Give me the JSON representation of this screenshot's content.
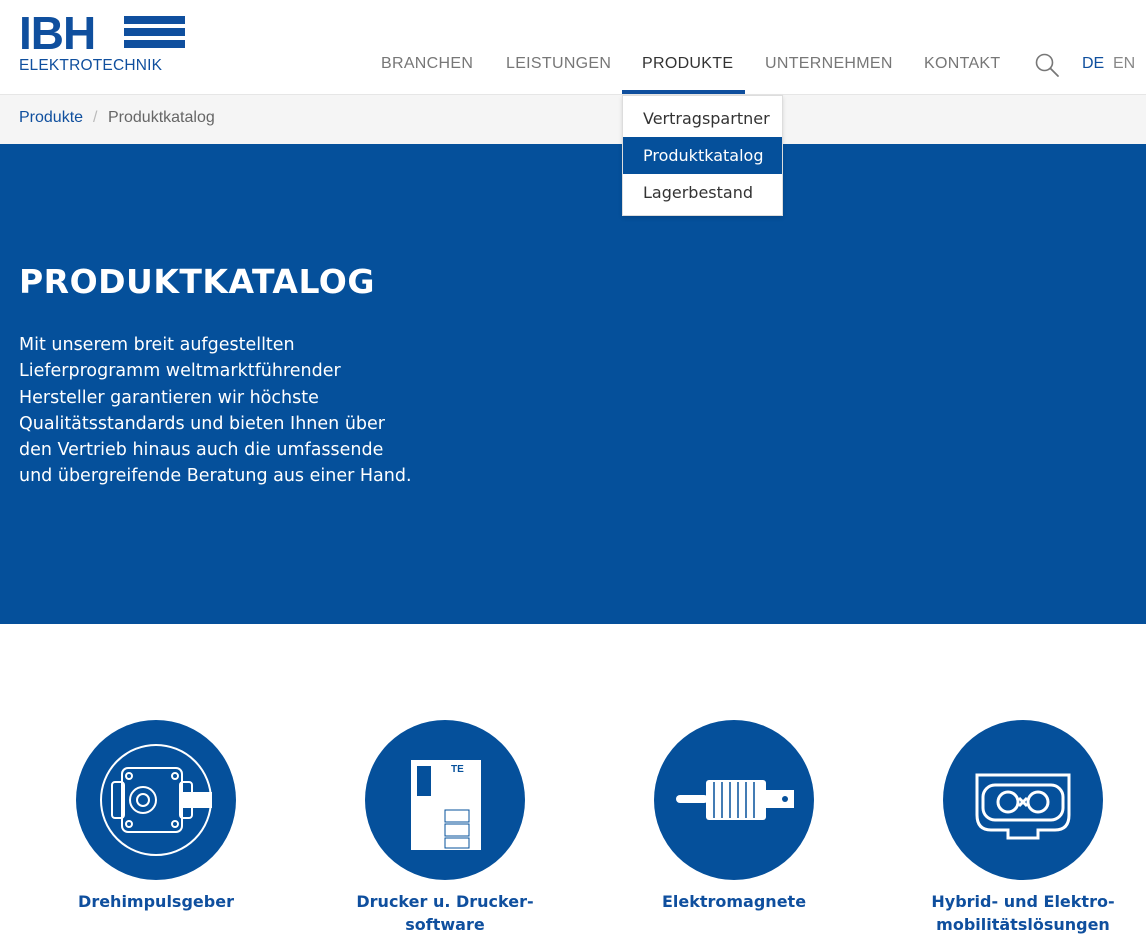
{
  "brand": {
    "name": "IBH",
    "subtitle": "ELEKTROTECHNIK",
    "color": "#0f4f9e"
  },
  "nav": {
    "items": [
      {
        "label": "BRANCHEN"
      },
      {
        "label": "LEISTUNGEN"
      },
      {
        "label": "PRODUKTE",
        "active": true
      },
      {
        "label": "UNTERNEHMEN"
      },
      {
        "label": "KONTAKT"
      }
    ],
    "search_icon": "search-icon",
    "languages": [
      {
        "label": "DE",
        "active": true
      },
      {
        "label": "EN",
        "active": false
      }
    ]
  },
  "dropdown": {
    "items": [
      {
        "label": "Vertragspartner"
      },
      {
        "label": "Produktkatalog",
        "selected": true
      },
      {
        "label": "Lagerbestand"
      }
    ]
  },
  "breadcrumb": {
    "parent": "Produkte",
    "separator": "/",
    "current": "Produktkatalog"
  },
  "hero": {
    "title": "PRODUKTKATALOG",
    "text": "Mit unserem breit aufgestellten Lieferprogramm weltmarktführender Hersteller garantieren wir höchste Qualitätsstandards und bieten Ihnen über den Vertrieb hinaus auch die umfassende und übergreifende Beratung aus einer Hand.",
    "background": "#05509b"
  },
  "products": [
    {
      "label": "Drehimpulsgeber",
      "icon": "rotary-encoder-icon"
    },
    {
      "label": "Drucker u. Drucker-software",
      "icon": "printer-icon",
      "icon_text": "TE"
    },
    {
      "label": "Elektromagnete",
      "icon": "electromagnet-icon"
    },
    {
      "label": "Hybrid- und Elektro-mobilitätslösungen",
      "icon": "connector-icon"
    }
  ]
}
